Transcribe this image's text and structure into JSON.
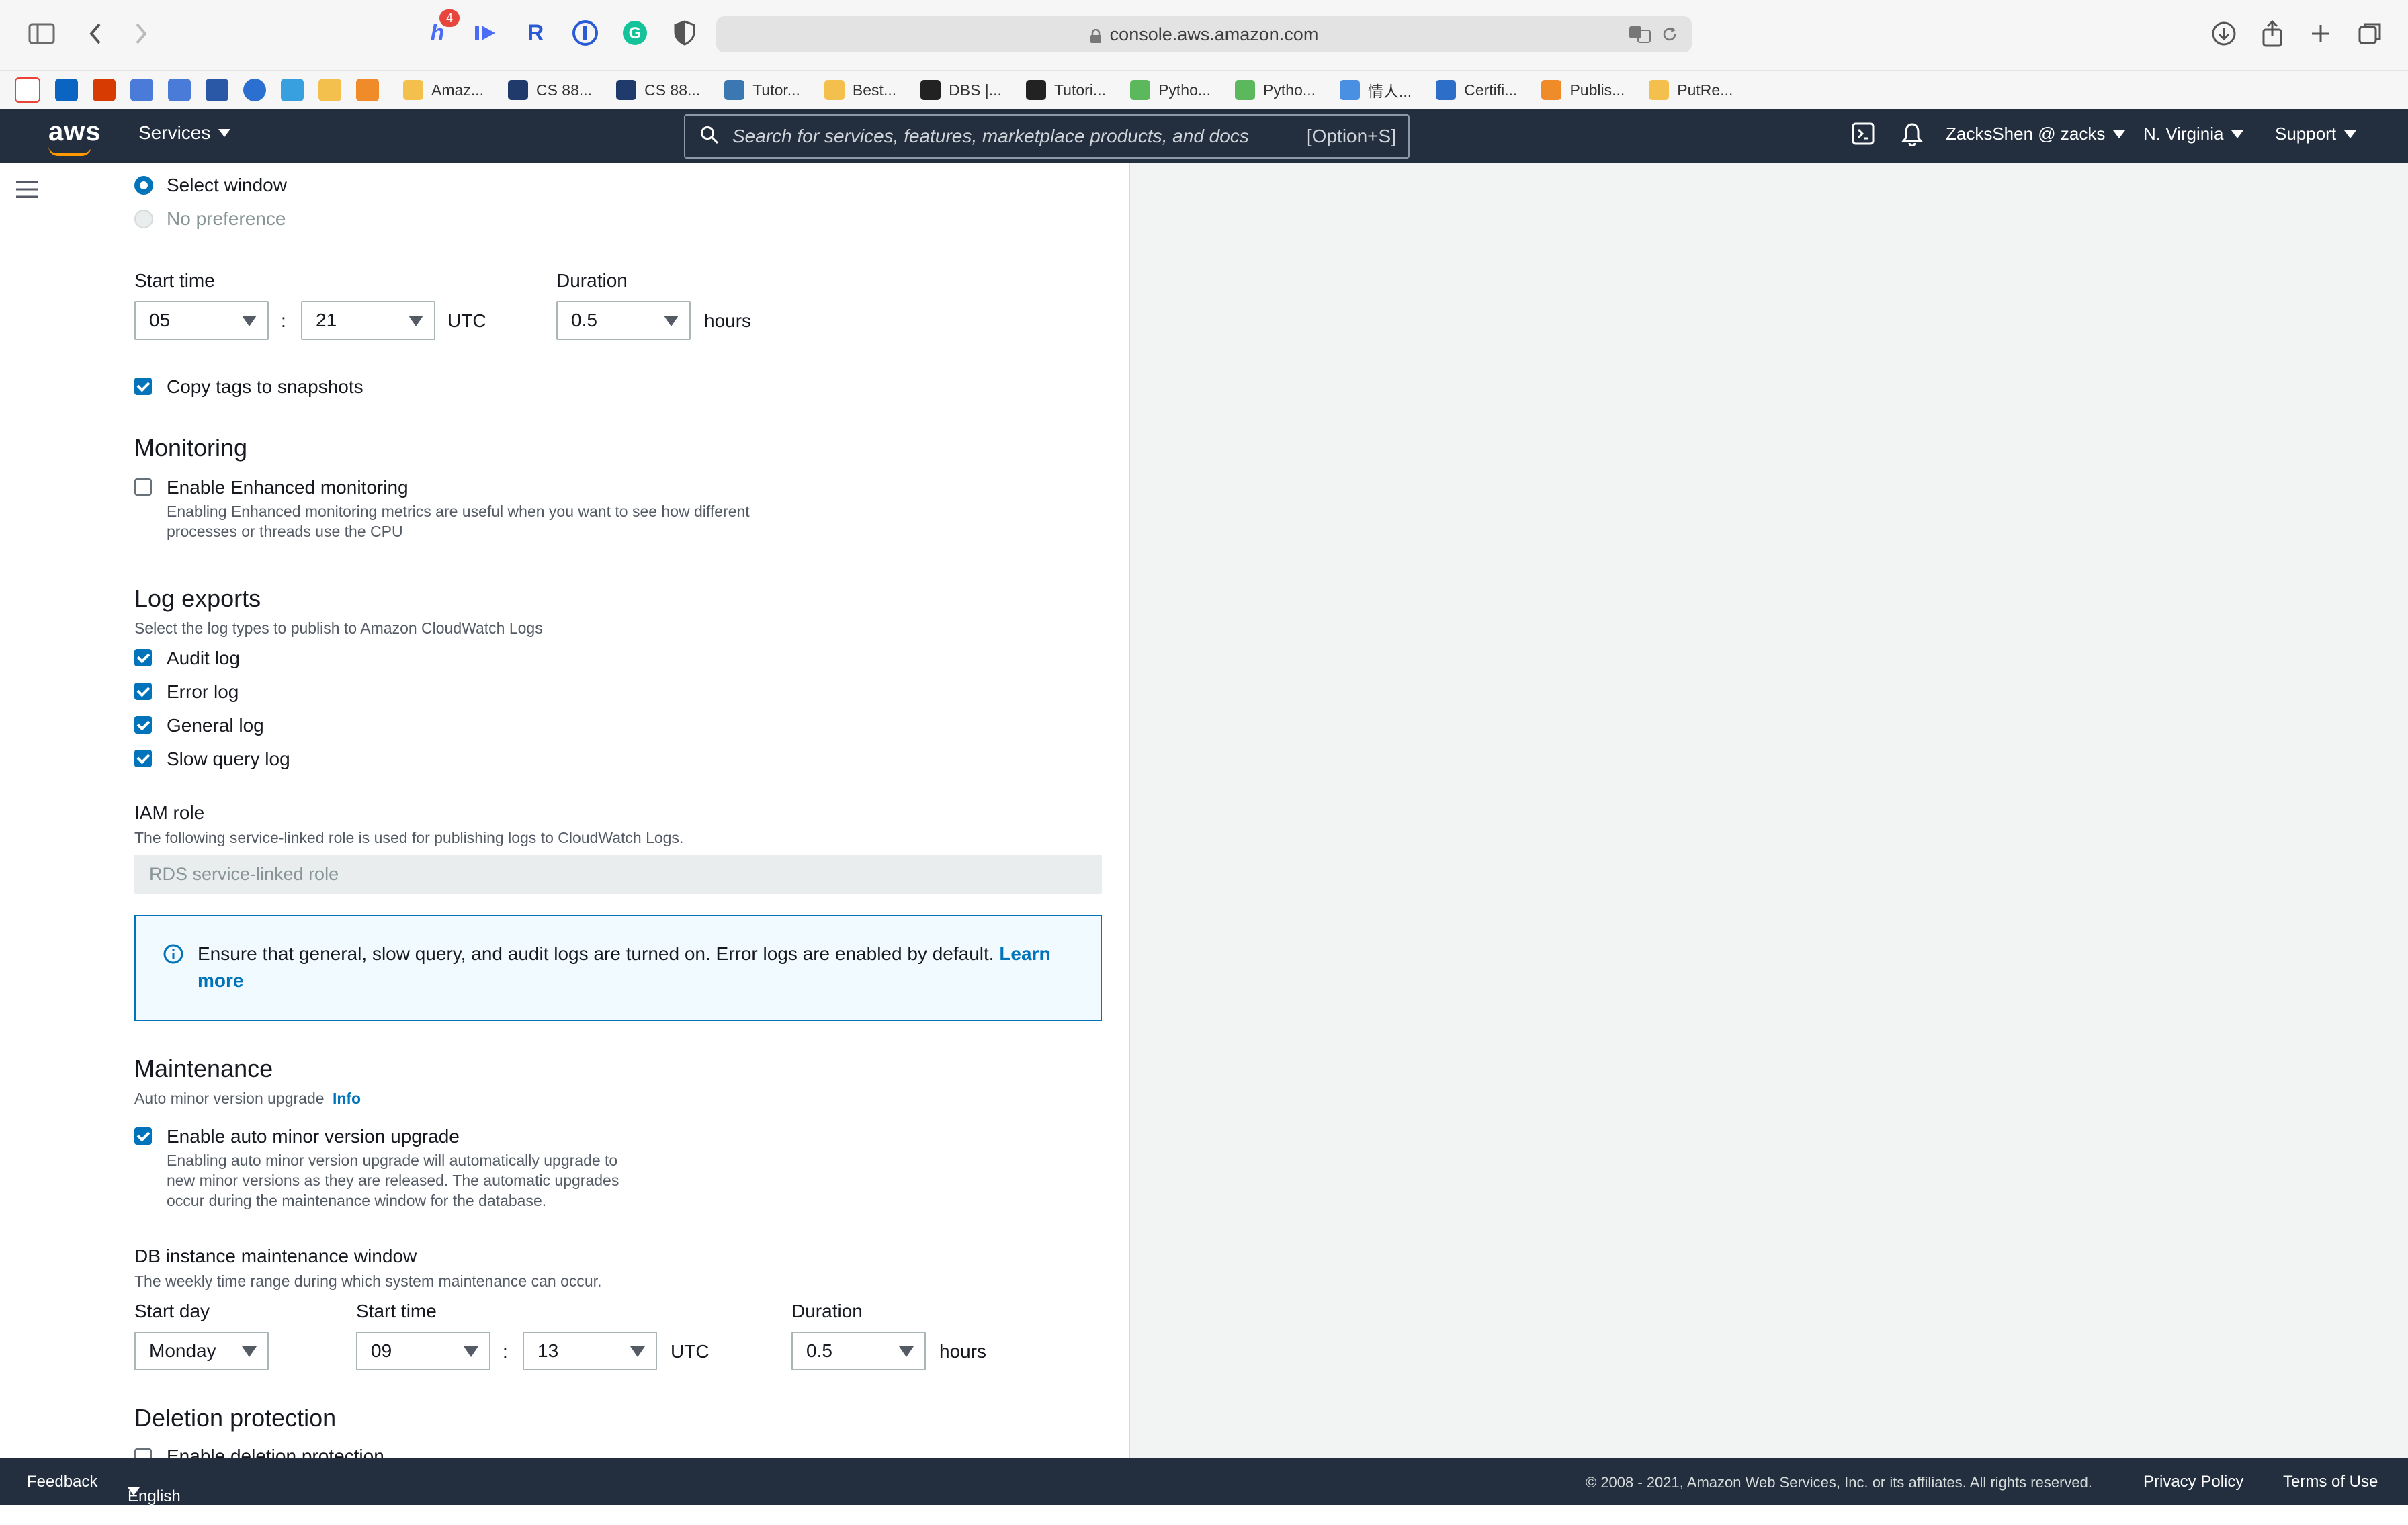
{
  "browser": {
    "url": "console.aws.amazon.com",
    "extension_badge": "4",
    "bookmarks": [
      "Amaz...",
      "CS 88...",
      "CS 88...",
      "Tutor...",
      "Best...",
      "DBS |...",
      "Tutori...",
      "Pytho...",
      "Pytho...",
      "情人...",
      "Certifi...",
      "Publis...",
      "PutRe..."
    ]
  },
  "nav": {
    "logo": "aws",
    "services": "Services",
    "search_placeholder": "Search for services, features, marketplace products, and docs",
    "search_shortcut": "[Option+S]",
    "user": "ZacksShen @ zacks",
    "region": "N. Virginia",
    "support": "Support"
  },
  "backup_window": {
    "option_select": "Select window",
    "option_no_pref": "No preference",
    "start_time_label": "Start time",
    "hour": "05",
    "minute": "21",
    "colon": ":",
    "utc": "UTC",
    "duration_label": "Duration",
    "duration": "0.5",
    "hours": "hours"
  },
  "copy_tags": "Copy tags to snapshots",
  "monitoring": {
    "title": "Monitoring",
    "enhanced_label": "Enable Enhanced monitoring",
    "enhanced_desc_1": "Enabling Enhanced monitoring metrics are useful when you want to see how different",
    "enhanced_desc_2": "processes or threads use the CPU"
  },
  "log_exports": {
    "title": "Log exports",
    "desc": "Select the log types to publish to Amazon CloudWatch Logs",
    "audit": "Audit log",
    "error": "Error log",
    "general": "General log",
    "slow": "Slow query log"
  },
  "iam_role": {
    "title": "IAM role",
    "desc": "The following service-linked role is used for publishing logs to CloudWatch Logs.",
    "value": "RDS service-linked role"
  },
  "info_alert": {
    "text": "Ensure that general, slow query, and audit logs are turned on. Error logs are enabled by default.",
    "link_1": "Learn",
    "link_2": "more"
  },
  "maintenance": {
    "title": "Maintenance",
    "auto_minor_label": "Auto minor version upgrade",
    "info": "Info",
    "enable_label": "Enable auto minor version upgrade",
    "enable_desc_1": "Enabling auto minor version upgrade will automatically upgrade to",
    "enable_desc_2": "new minor versions as they are released. The automatic upgrades",
    "enable_desc_3": "occur during the maintenance window for the database.",
    "window_title": "DB instance maintenance window",
    "window_desc": "The weekly time range during which system maintenance can occur.",
    "start_day_label": "Start day",
    "start_day": "Monday",
    "start_time_label": "Start time",
    "hour": "09",
    "minute": "13",
    "colon": ":",
    "utc": "UTC",
    "duration_label": "Duration",
    "duration": "0.5",
    "hours": "hours"
  },
  "deletion": {
    "title": "Deletion protection",
    "label": "Enable deletion protection"
  },
  "footer": {
    "feedback": "Feedback",
    "language": "English (US)",
    "copyright": "© 2008 - 2021, Amazon Web Services, Inc. or its affiliates. All rights reserved.",
    "privacy": "Privacy Policy",
    "terms": "Terms of Use"
  }
}
